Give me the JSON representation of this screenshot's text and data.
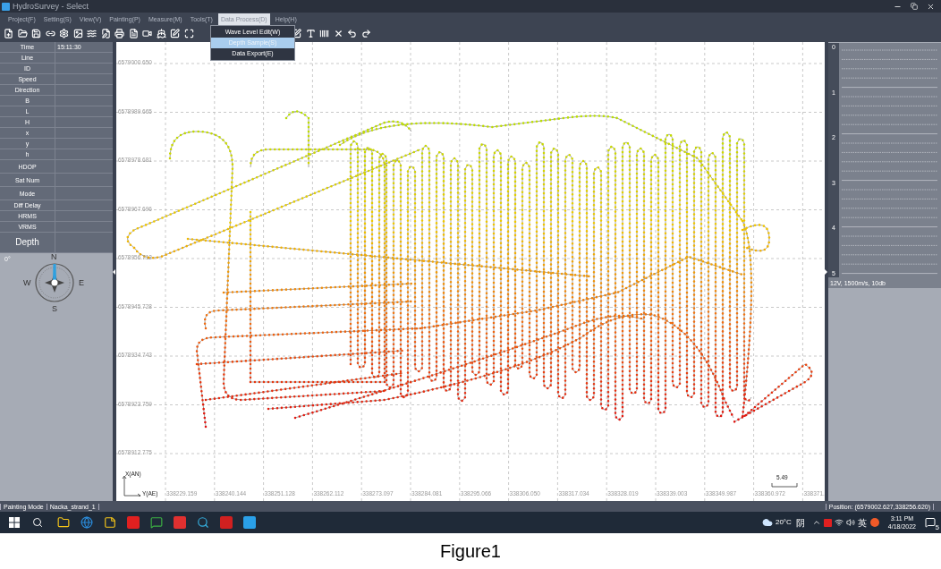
{
  "window": {
    "title": "HydroSurvey - Select"
  },
  "menu": [
    {
      "label": "Project(F)",
      "selected": false
    },
    {
      "label": "Setting(S)",
      "selected": false
    },
    {
      "label": "View(V)",
      "selected": false
    },
    {
      "label": "Painting(P)",
      "selected": false
    },
    {
      "label": "Measure(M)",
      "selected": false
    },
    {
      "label": "Tools(T)",
      "selected": false
    },
    {
      "label": "Data Process(D)",
      "selected": true
    },
    {
      "label": "Help(H)",
      "selected": false
    }
  ],
  "dropdown": [
    {
      "label": "Wave Level Edit(W)",
      "selected": false
    },
    {
      "label": "Depth Sample(S)",
      "selected": true
    },
    {
      "label": "Data Export(E)",
      "selected": false
    }
  ],
  "info_table": [
    {
      "label": "Time",
      "value": "15:11:30",
      "kind": "normal"
    },
    {
      "label": "Line",
      "kind": "normal"
    },
    {
      "label": "ID",
      "kind": "normal"
    },
    {
      "label": "Speed",
      "kind": "normal"
    },
    {
      "label": "Direction",
      "kind": "normal"
    },
    {
      "label": "B",
      "kind": "normal"
    },
    {
      "label": "L",
      "kind": "normal"
    },
    {
      "label": "H",
      "kind": "normal"
    },
    {
      "label": "x",
      "kind": "normal"
    },
    {
      "label": "y",
      "kind": "normal"
    },
    {
      "label": "h",
      "kind": "normal"
    },
    {
      "label": "HDOP",
      "kind": "tall"
    },
    {
      "label": "Sat Num",
      "kind": "tall"
    },
    {
      "label": "Mode",
      "kind": "tall"
    },
    {
      "label": "Diff Delay",
      "kind": "normal"
    },
    {
      "label": "HRMS",
      "kind": "normal"
    },
    {
      "label": "VRMS",
      "kind": "normal"
    },
    {
      "label": "Depth",
      "kind": "large"
    }
  ],
  "compass": {
    "heading": "0°",
    "north": "N",
    "west": "W",
    "east": "E",
    "south": "S"
  },
  "plot": {
    "y_labels": [
      "6579000.650",
      "6578989.665",
      "6578978.681",
      "6578967.696",
      "6578956.712",
      "6578945.728",
      "6578934.743",
      "6578923.759",
      "6578912.775"
    ],
    "x_labels": [
      "338229.159",
      "338240.144",
      "338251.128",
      "338262.112",
      "338273.097",
      "338284.081",
      "338295.066",
      "338306.050",
      "338317.034",
      "338328.019",
      "338339.003",
      "338349.987",
      "338360.972",
      "338371."
    ],
    "axis_x": "X(AN)",
    "axis_y": "Y(AE)",
    "scale": "5.49"
  },
  "depth_panel": {
    "ticks": [
      "0",
      "1",
      "2",
      "3",
      "4",
      "5"
    ],
    "info": "12V, 1500m/s, 10db"
  },
  "status_bar": {
    "mode": "Painting Mode",
    "file": "Nacka_strand_1",
    "position": "Position: (6579002.627,338256.620)"
  },
  "taskbar": {
    "weather": "20°C",
    "condition": "阴",
    "ime": "英",
    "time": "3:11 PM",
    "date": "4/18/2022",
    "notifications": "5"
  },
  "caption": "Figure1"
}
